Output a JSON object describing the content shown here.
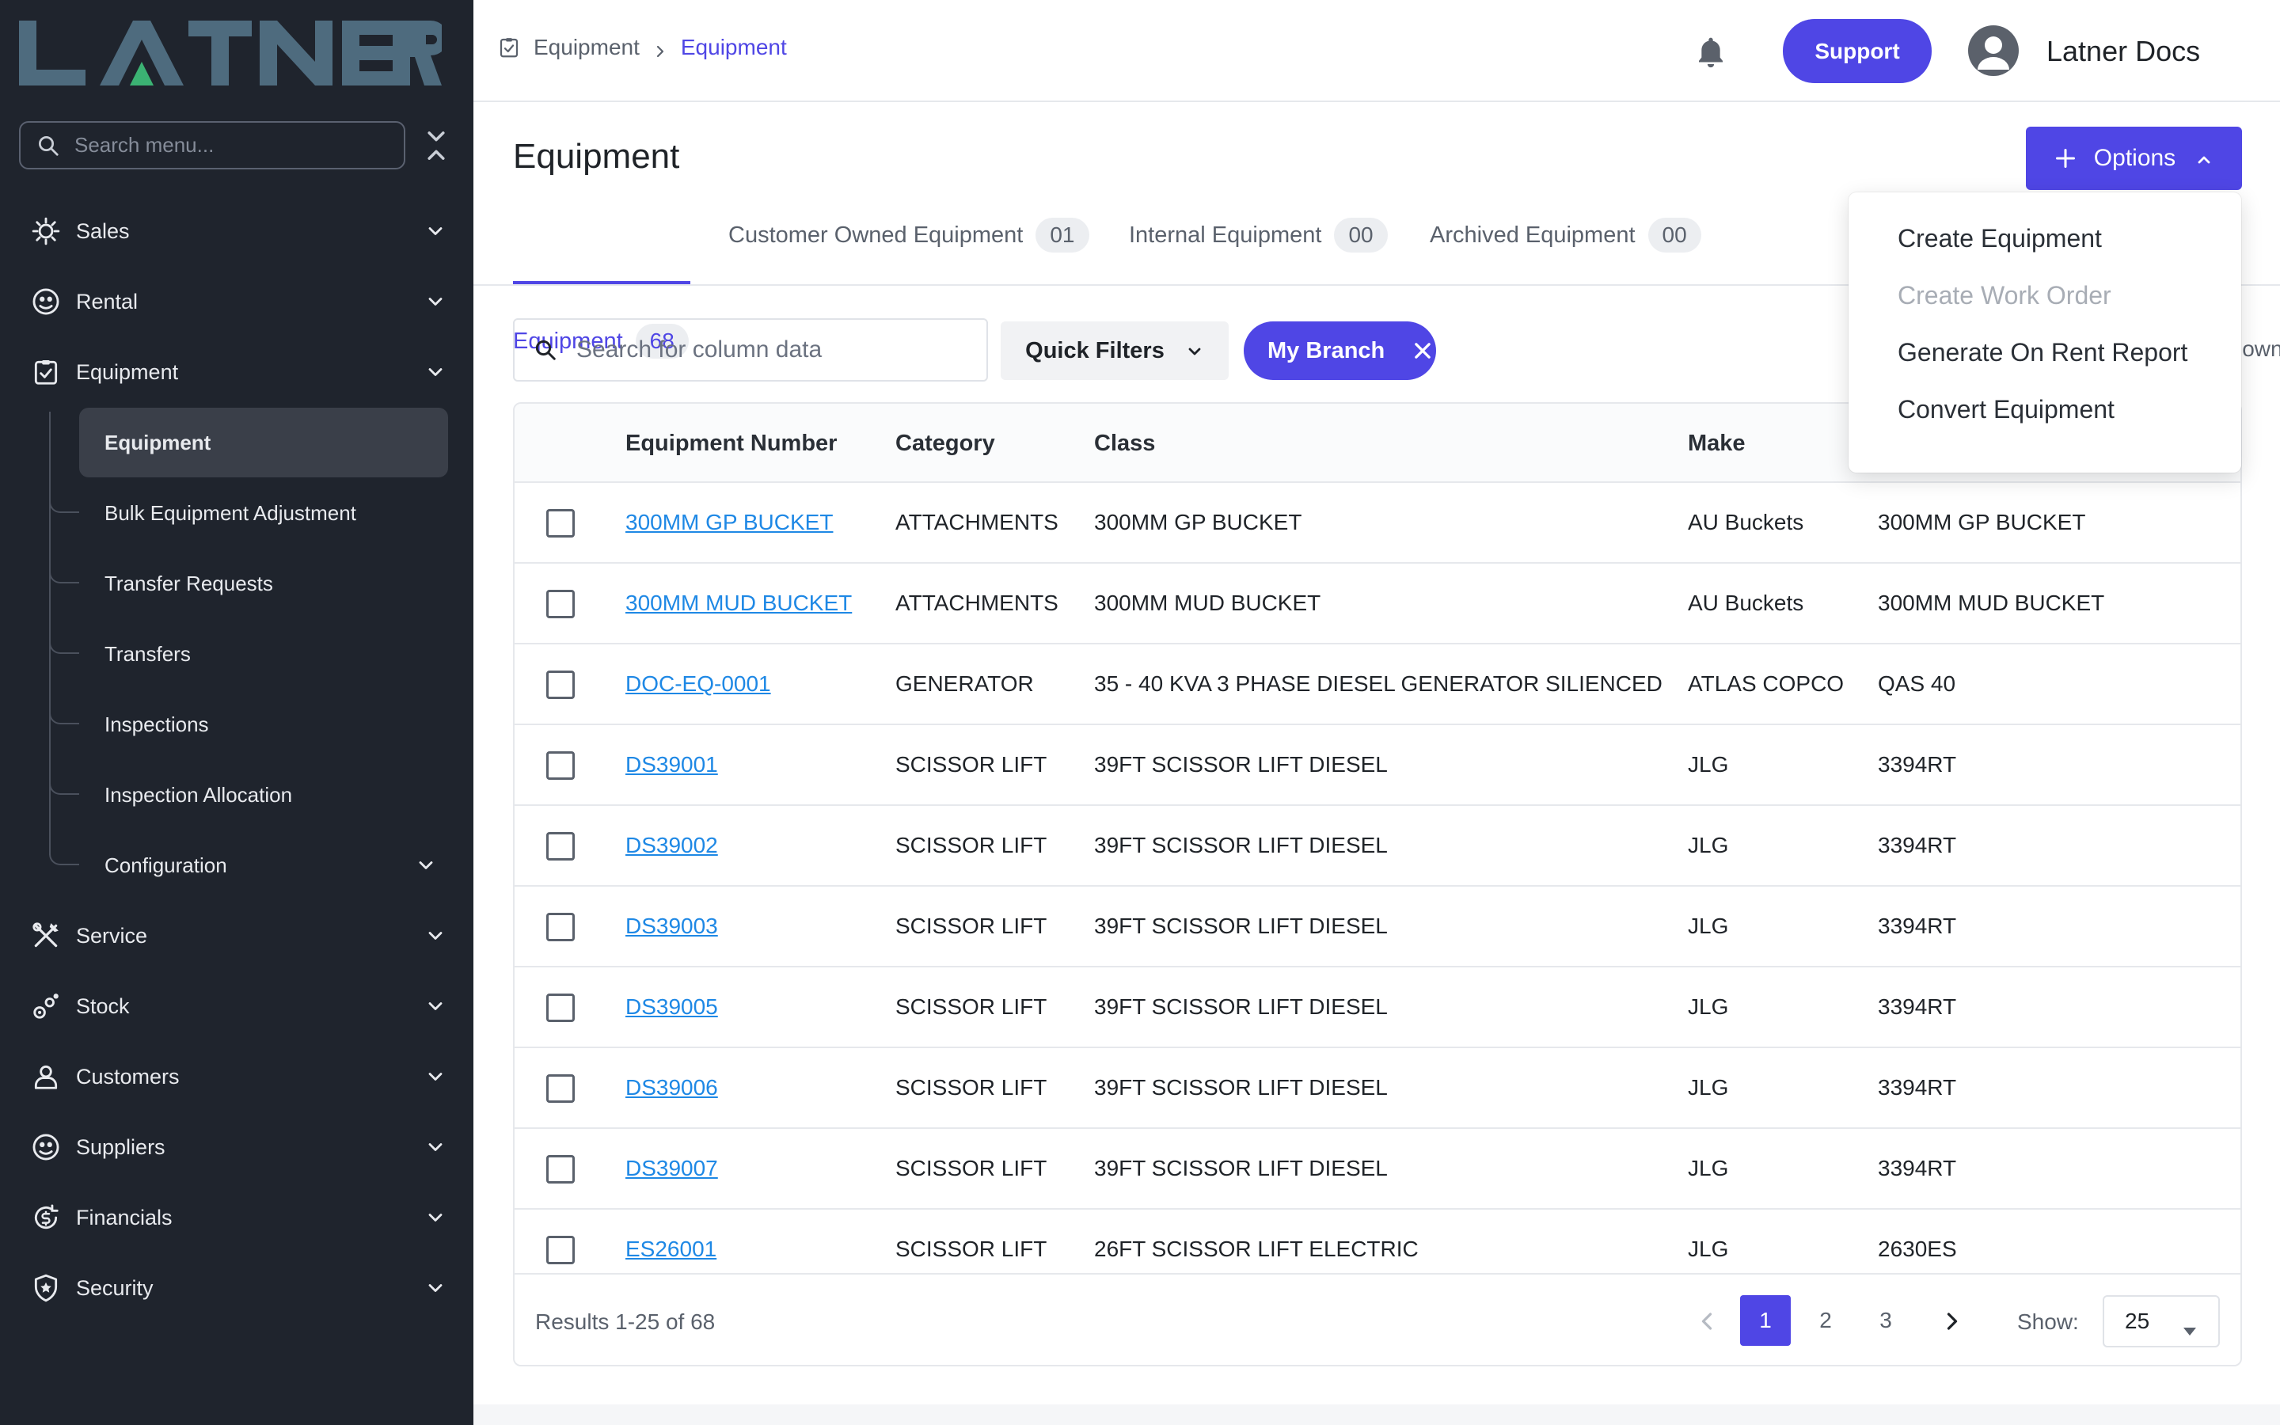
{
  "brand": {
    "logo_text": "LATNER"
  },
  "sidebar": {
    "search_placeholder": "Search menu...",
    "items": [
      {
        "label": "Sales",
        "icon": "sales-icon"
      },
      {
        "label": "Rental",
        "icon": "rental-icon"
      },
      {
        "label": "Equipment",
        "icon": "equipment-icon"
      },
      {
        "label": "Service",
        "icon": "service-icon"
      },
      {
        "label": "Stock",
        "icon": "stock-icon"
      },
      {
        "label": "Customers",
        "icon": "customers-icon"
      },
      {
        "label": "Suppliers",
        "icon": "suppliers-icon"
      },
      {
        "label": "Financials",
        "icon": "financials-icon"
      },
      {
        "label": "Security",
        "icon": "security-icon"
      }
    ],
    "equipment_sub": [
      "Equipment",
      "Bulk Equipment Adjustment",
      "Transfer Requests",
      "Transfers",
      "Inspections",
      "Inspection Allocation",
      "Configuration"
    ]
  },
  "header": {
    "breadcrumb": [
      "Equipment",
      "Equipment"
    ],
    "support_label": "Support",
    "user_name": "Latner Docs"
  },
  "main": {
    "title": "Equipment",
    "options_label": "Options",
    "tabs": [
      {
        "label": "Equipment",
        "count": "68"
      },
      {
        "label": "Customer Owned Equipment",
        "count": "01"
      },
      {
        "label": "Internal Equipment",
        "count": "00"
      },
      {
        "label": "Archived Equipment",
        "count": "00"
      }
    ],
    "search_placeholder": "Search for column data",
    "quick_filters_label": "Quick Filters",
    "branch_chip_label": "My Branch",
    "download_label": "Download"
  },
  "options_menu": {
    "items": [
      {
        "label": "Create Equipment",
        "disabled": false
      },
      {
        "label": "Create Work Order",
        "disabled": true
      },
      {
        "label": "Generate On Rent Report",
        "disabled": false
      },
      {
        "label": "Convert Equipment",
        "disabled": false
      }
    ]
  },
  "table": {
    "columns": [
      "Equipment Number",
      "Category",
      "Class",
      "Make"
    ],
    "rows": [
      [
        "300MM GP BUCKET",
        "ATTACHMENTS",
        "300MM GP BUCKET",
        "AU Buckets",
        "300MM GP BUCKET"
      ],
      [
        "300MM MUD BUCKET",
        "ATTACHMENTS",
        "300MM MUD BUCKET",
        "AU Buckets",
        "300MM MUD BUCKET"
      ],
      [
        "DOC-EQ-0001",
        "GENERATOR",
        "35 - 40 KVA 3 PHASE DIESEL GENERATOR SILIENCED",
        "ATLAS COPCO",
        "QAS 40"
      ],
      [
        "DS39001",
        "SCISSOR LIFT",
        "39FT SCISSOR LIFT DIESEL",
        "JLG",
        "3394RT"
      ],
      [
        "DS39002",
        "SCISSOR LIFT",
        "39FT SCISSOR LIFT DIESEL",
        "JLG",
        "3394RT"
      ],
      [
        "DS39003",
        "SCISSOR LIFT",
        "39FT SCISSOR LIFT DIESEL",
        "JLG",
        "3394RT"
      ],
      [
        "DS39005",
        "SCISSOR LIFT",
        "39FT SCISSOR LIFT DIESEL",
        "JLG",
        "3394RT"
      ],
      [
        "DS39006",
        "SCISSOR LIFT",
        "39FT SCISSOR LIFT DIESEL",
        "JLG",
        "3394RT"
      ],
      [
        "DS39007",
        "SCISSOR LIFT",
        "39FT SCISSOR LIFT DIESEL",
        "JLG",
        "3394RT"
      ],
      [
        "ES26001",
        "SCISSOR LIFT",
        "26FT SCISSOR LIFT ELECTRIC",
        "JLG",
        "2630ES"
      ]
    ]
  },
  "pagination": {
    "results_text": "Results 1-25 of 68",
    "pages": [
      "1",
      "2",
      "3"
    ],
    "current_page": "1",
    "show_label": "Show:",
    "page_size": "25"
  },
  "colors": {
    "accent": "#4f46e5",
    "sidebar_bg": "#1f242d",
    "link": "#1e88e5",
    "logo": "#4e6b7e",
    "logo_mark": "#3bb273"
  }
}
